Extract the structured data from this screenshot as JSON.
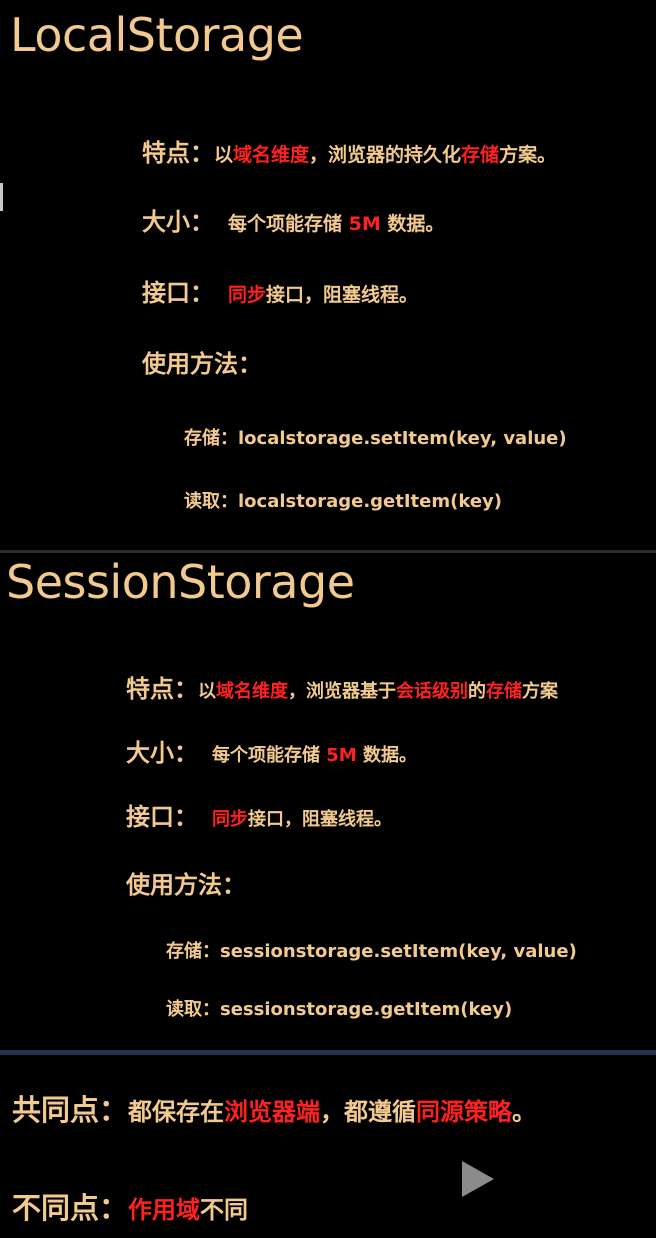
{
  "local": {
    "title": "LocalStorage",
    "feature": {
      "label": "特点：",
      "p1": "以",
      "r1": "域名维度",
      "p2": "，浏览器的持久化",
      "r2": "存储",
      "p3": "方案。"
    },
    "size": {
      "label": "大小：",
      "p1": "每个项能存储 ",
      "r1": "5M",
      "p2": " 数据。"
    },
    "api": {
      "label": "接口：",
      "r1": "同步",
      "p1": "接口，阻塞线程。"
    },
    "usage": {
      "label": "使用方法："
    },
    "store": {
      "label": "存储：",
      "code": "localstorage.setItem(key, value)"
    },
    "read": {
      "label": "读取：",
      "code": "localstorage.getItem(key)"
    }
  },
  "session": {
    "title": "SessionStorage",
    "feature": {
      "label": "特点：",
      "p1": "以",
      "r1": "域名维度",
      "p2": "，浏览器基于",
      "r2": "会话级别",
      "p3": "的",
      "r3": "存储",
      "p4": "方案"
    },
    "size": {
      "label": "大小：",
      "p1": "每个项能存储 ",
      "r1": "5M",
      "p2": " 数据。"
    },
    "api": {
      "label": "接口：",
      "r1": "同步",
      "p1": "接口，阻塞线程。"
    },
    "usage": {
      "label": "使用方法："
    },
    "store": {
      "label": "存储：",
      "code": "sessionstorage.setItem(key, value)"
    },
    "read": {
      "label": "读取：",
      "code": "sessionstorage.getItem(key)"
    }
  },
  "summary": {
    "same": {
      "label": "共同点：",
      "p1": "都保存在",
      "r1": "浏览器端",
      "p2": "，都遵循",
      "r2": "同源策略",
      "p3": "。"
    },
    "diff": {
      "label": "不同点：",
      "r1": "作用域",
      "p1": "不同"
    }
  },
  "icons": {
    "play": "play-icon"
  },
  "colors": {
    "background": "#000000",
    "text": "#f2c98e",
    "highlight": "#ff2020"
  }
}
